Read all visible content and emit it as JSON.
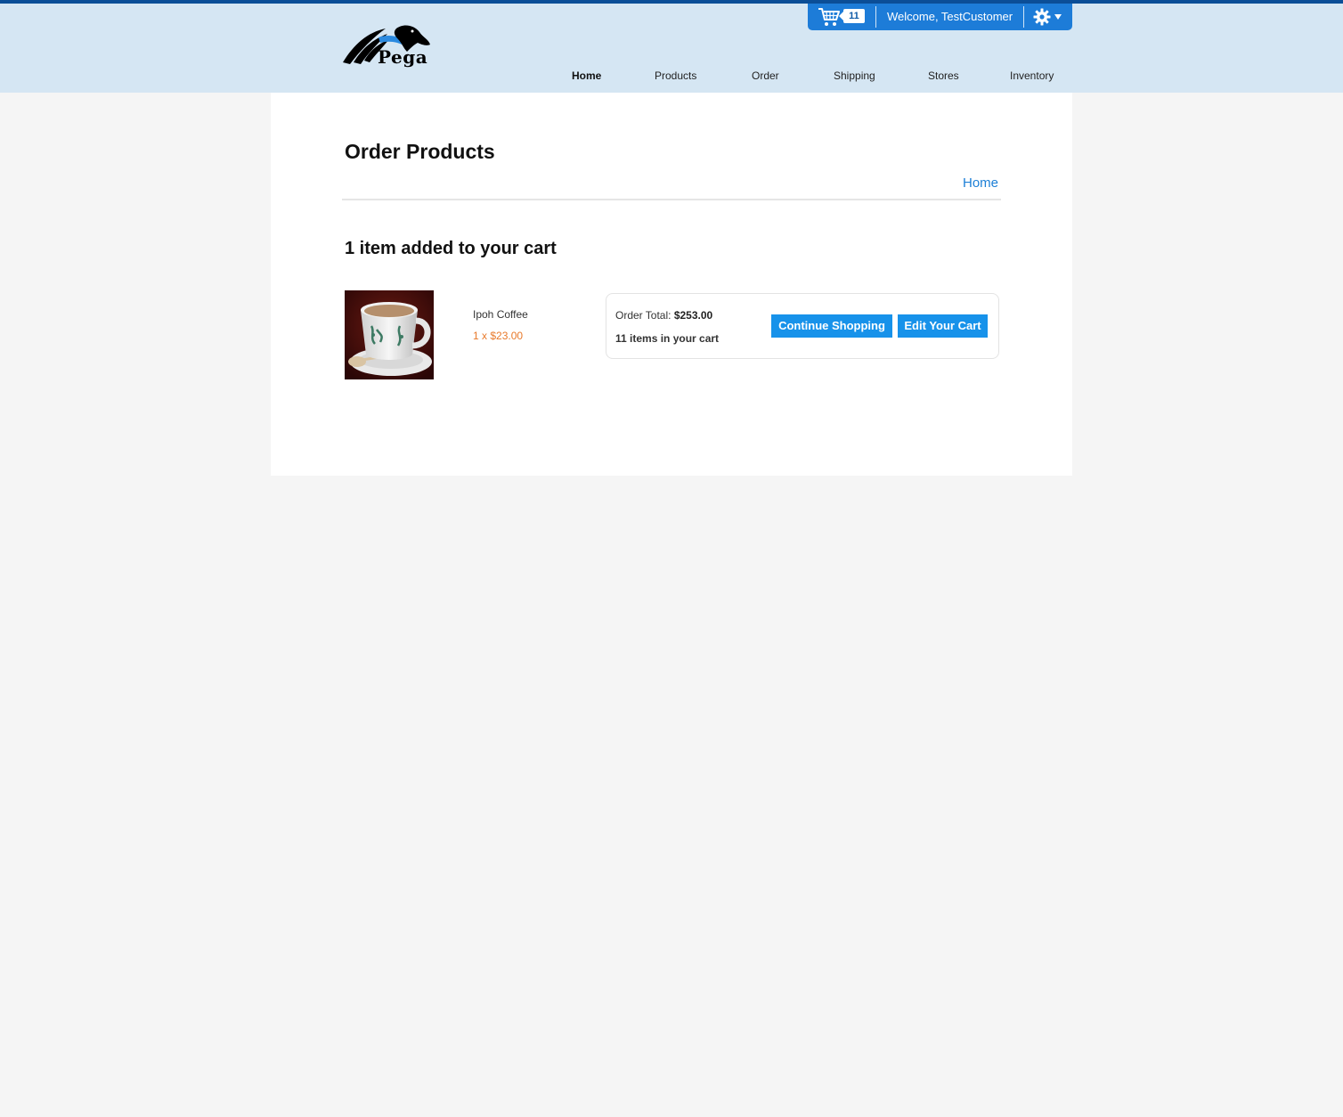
{
  "header": {
    "logo_text": "Pega",
    "cart_count": "11",
    "welcome_text": "Welcome, TestCustomer",
    "icons": {
      "cart": "cart-icon",
      "settings": "gear-icon",
      "dropdown": "caret-down-icon"
    }
  },
  "nav": {
    "items": [
      {
        "label": "Home",
        "active": true
      },
      {
        "label": "Products",
        "active": false
      },
      {
        "label": "Order",
        "active": false
      },
      {
        "label": "Shipping",
        "active": false
      },
      {
        "label": "Stores",
        "active": false
      },
      {
        "label": "Inventory",
        "active": false
      }
    ]
  },
  "page": {
    "title": "Order Products",
    "breadcrumb_home": "Home",
    "added_message": "1 item added to your cart"
  },
  "product": {
    "name": "Ipoh Coffee",
    "price_line": "1 x $23.00"
  },
  "summary": {
    "order_total_label": "Order Total: ",
    "order_total_value": "$253.00",
    "items_in_cart": "11 items in your cart",
    "continue_label": "Continue Shopping",
    "edit_label": "Edit Your Cart"
  },
  "colors": {
    "accent": "#1792ea",
    "header_bg": "#d5e6f3",
    "price": "#e8792a",
    "link": "#1c7fd6"
  }
}
